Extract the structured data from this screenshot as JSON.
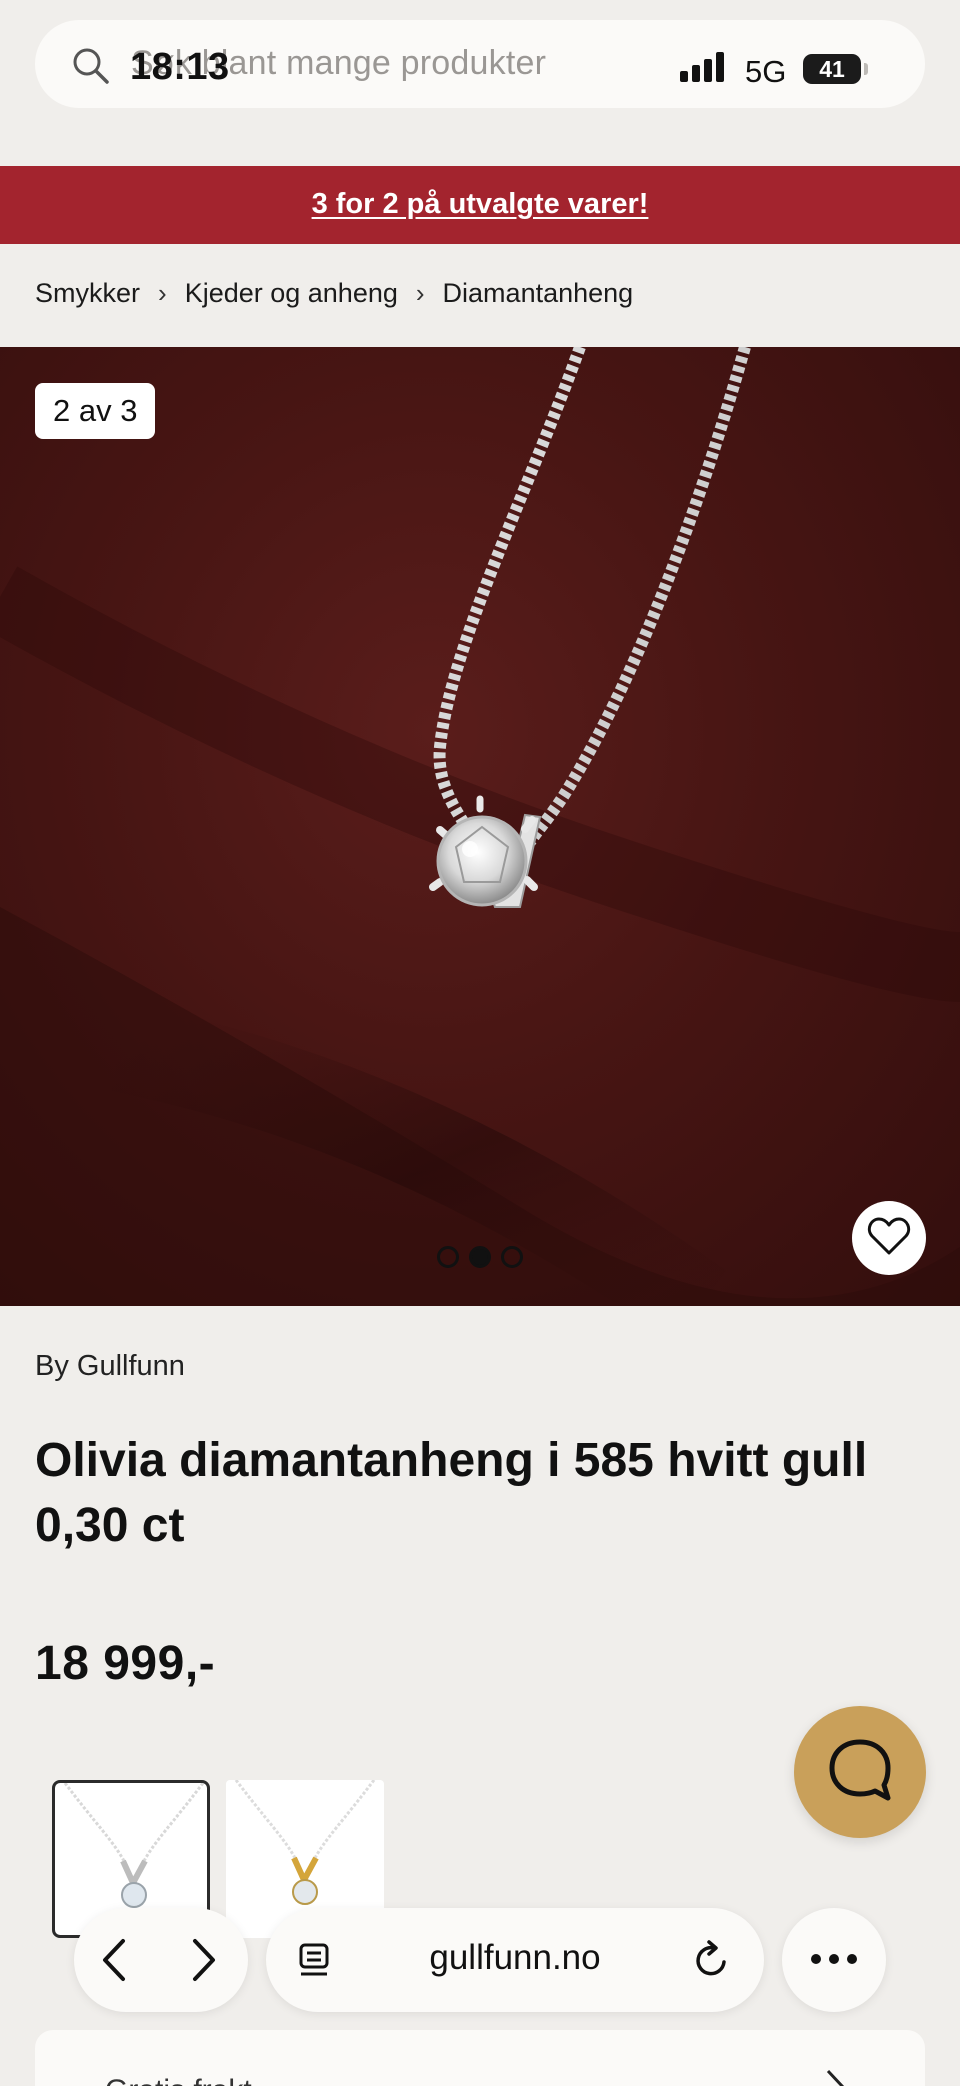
{
  "search": {
    "placeholder": "Søk blant mange produkter"
  },
  "status_bar": {
    "time": "18:13",
    "network": "5G",
    "battery": "41"
  },
  "promo": {
    "text": "3 for 2 på utvalgte varer!"
  },
  "breadcrumb": {
    "items": [
      "Smykker",
      "Kjeder og anheng",
      "Diamantanheng"
    ],
    "separator": "›"
  },
  "gallery": {
    "counter": "2 av 3",
    "total_images": 3,
    "active_index": 2
  },
  "product": {
    "brand": "By Gullfunn",
    "title": "Olivia diamantanheng i 585 hvitt gull 0,30 ct",
    "price": "18 999,-",
    "variants": [
      {
        "metal": "white-gold",
        "selected": true
      },
      {
        "metal": "yellow-gold",
        "selected": false
      }
    ]
  },
  "browser": {
    "url": "gullfunn.no"
  },
  "bottom_card": {
    "text": "Gratis frakt"
  },
  "colors": {
    "promo_bg": "#a3242e",
    "chat_button": "#c9a05a",
    "page_bg": "#f0eeeb",
    "photo_bg": "#471513"
  },
  "icons": [
    "search-icon",
    "signal-icon",
    "heart-icon",
    "chat-icon",
    "back-icon",
    "forward-icon",
    "reader-icon",
    "reload-icon",
    "more-icon",
    "chevron-right-icon"
  ]
}
